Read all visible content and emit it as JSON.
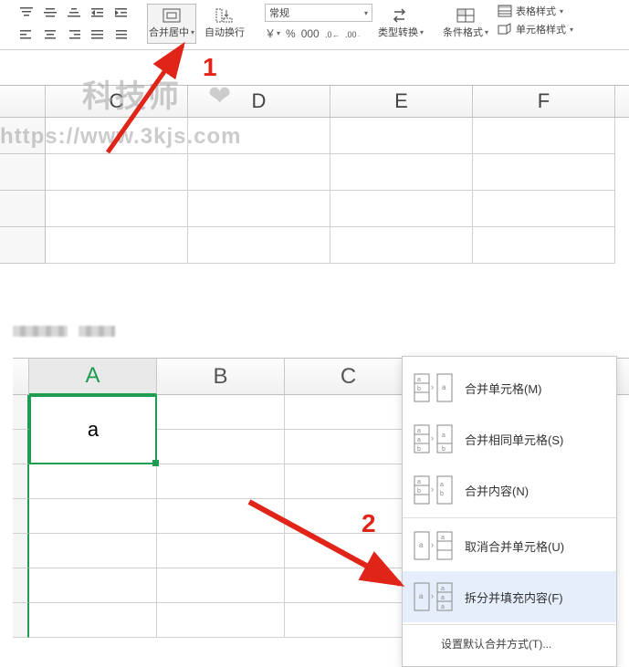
{
  "ribbon": {
    "merge_center": "合并居中",
    "wrap_text": "自动换行",
    "number_format_selected": "常规",
    "symbols": {
      "yen": "￥",
      "percent": "%",
      "thousand": "000",
      "inc_dec_a": "←0.0",
      "inc_dec_b": ".00→"
    },
    "type_convert": "类型转换",
    "cond_format": "条件格式",
    "table_style": "表格样式",
    "cell_style": "单元格样式"
  },
  "watermark": {
    "text": "科技师",
    "url": "https://www.3kjs.com"
  },
  "badges": {
    "one": "1",
    "two": "2"
  },
  "grid1": {
    "cols": [
      "C",
      "D",
      "E",
      "F"
    ]
  },
  "grid2": {
    "cols": [
      "A",
      "B",
      "C"
    ],
    "cell_value": "a"
  },
  "menu": {
    "items": [
      {
        "key": "merge_cells",
        "label": "合并单元格(M)"
      },
      {
        "key": "merge_same",
        "label": "合并相同单元格(S)"
      },
      {
        "key": "merge_content",
        "label": "合并内容(N)"
      },
      {
        "key": "unmerge",
        "label": "取消合并单元格(U)"
      },
      {
        "key": "split_fill",
        "label": "拆分并填充内容(F)"
      }
    ],
    "footer": "设置默认合并方式(T)..."
  }
}
